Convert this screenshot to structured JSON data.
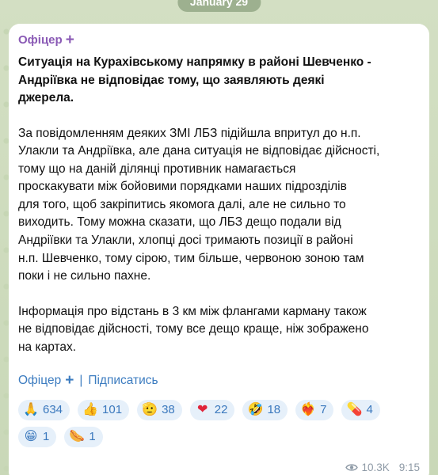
{
  "date_pill": "January 29",
  "message": {
    "sender": "Офіцер",
    "headline_lines": [
      "Ситуація на Курахівському напрямку в районі Шевченко -",
      "Андріївка не відповідає тому, що заявляють деякі",
      "джерела."
    ],
    "paragraph1_lines": [
      "За повідомленням деяких ЗМІ ЛБЗ підійшла впритул до н.п.",
      "Улакли та Андріївка, але дана ситуація не відповідає дійсності,",
      "тому що на даній ділянці противник намагається",
      "проскакувати між бойовими порядками наших підрозділів",
      "для того, щоб закріпитись якомога далі, але не сильно то",
      "виходить. Тому можна сказати, що ЛБЗ дещо подали від",
      "Андріївки та Улакли, хлопці досі тримають позиції в районі",
      "н.п. Шевченко, тому сірою, тим більше, червоною зоною там",
      "поки і не сильно пахне."
    ],
    "paragraph2_lines": [
      "Інформація про відстань в 3 км між флангами карману також",
      "не відповідає дійсності, тому все дещо краще, ніж зображено",
      "на картах."
    ],
    "signature": {
      "channel": "Офіцер",
      "separator": "|",
      "subscribe": "Підписатись"
    },
    "reactions": [
      {
        "emoji": "🙏",
        "icon": "pray-icon",
        "count": "634"
      },
      {
        "emoji": "👍",
        "icon": "thumbs-up-icon",
        "count": "101"
      },
      {
        "emoji": "🫡",
        "icon": "salute-icon",
        "count": "38"
      },
      {
        "emoji": "❤",
        "icon": "heart-icon",
        "count": "22"
      },
      {
        "emoji": "🤣",
        "icon": "rofl-icon",
        "count": "18"
      },
      {
        "emoji": "❤‍🔥",
        "icon": "heart-fire-icon",
        "count": "7"
      },
      {
        "emoji": "💊",
        "icon": "pill-icon",
        "count": "4"
      },
      {
        "emoji": "😁",
        "icon": "grin-icon",
        "count": "1"
      },
      {
        "emoji": "🌭",
        "icon": "hotdog-icon",
        "count": "1"
      }
    ],
    "views": "10.3K",
    "time": "9:15"
  },
  "colors": {
    "sender": "#8a5ab5",
    "link": "#3c7cc0",
    "reaction_bg": "#e6f0fa",
    "meta": "#8e9aa6"
  }
}
